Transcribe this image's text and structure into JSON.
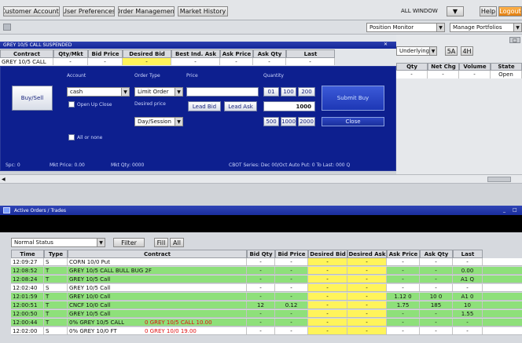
{
  "menu": {
    "tabs": [
      "Customer Accounts",
      "User Preferences",
      "Order Management",
      "Market History"
    ],
    "window_label": "ALL WINDOW",
    "help": "Help",
    "logout": "Logout"
  },
  "toolbar": {
    "position_dd": "Position Monitor",
    "manage_dd": "Manage Portfolios"
  },
  "quote_grid": {
    "title": "GREY 10/5 CALL  SUSPENDED",
    "headers": [
      "Contract",
      "Qty/Mkt",
      "Bid Price",
      "Desired Bid",
      "Best Ind. Ask",
      "Ask Price",
      "Ask Qty",
      "Last"
    ],
    "row": [
      "GREY 10/5 CALL",
      "-",
      "-",
      "-",
      "-",
      "-",
      "-",
      "-"
    ]
  },
  "order_ticket": {
    "labels": {
      "account": "Account",
      "order_type": "Order Type",
      "price": "Price",
      "quantity": "Quantity"
    },
    "buysell_button": "Buy/Sell",
    "account_value": "cash",
    "open_close_label": "Open Up Close",
    "order_type_value": "Limit Order",
    "desired_label": "Desired price",
    "lead_bid": "Lead Bid",
    "lead_ask": "Lead Ask",
    "qty_buttons": [
      "01",
      "100",
      "200"
    ],
    "qty_value": "1000",
    "qty_buttons2": [
      "500",
      "1000",
      "2000"
    ],
    "tif_value": "Day/Session",
    "submit_button": "Submit Buy",
    "close_button": "Close",
    "all_or_none": "All or none",
    "status": [
      "Spc: 0",
      "Mkt Price: 0.00",
      "Mkt Qty: 0000",
      "CBOT Series: Dec 00/Oct  Auto Put: 0 To  Last: 000 Q"
    ]
  },
  "right_panel": {
    "filter_value": "Underlying",
    "btn_a": "5A",
    "btn_b": "4H",
    "headers": [
      "Qty",
      "Net Chg",
      "Volume",
      "State"
    ],
    "row": [
      "-",
      "-",
      "-",
      "Open"
    ]
  },
  "lower_window": {
    "title": "Active Orders / Trades",
    "filter_value": "Normal Status",
    "filter_btn": "Filter",
    "btn1": "Fill",
    "btn2": "All",
    "headers": [
      "Time",
      "Type",
      "Contract",
      "Bid Qty",
      "Bid Price",
      "Desired Bid",
      "Desired Ask",
      "Ask Price",
      "Ask Qty",
      "Last"
    ],
    "rows": [
      {
        "time": "12:09:27",
        "type": "S",
        "contract": "CORN 10/0 Put",
        "bq": "-",
        "bp": "-",
        "db": "-",
        "da": "-",
        "ap": "-",
        "aq": "-",
        "last": "-",
        "color": "#ffffff"
      },
      {
        "time": "12:08:52",
        "type": "T",
        "contract": "GREY 10/5 CALL BULL BUG 2F",
        "bq": "-",
        "bp": "-",
        "db": "-",
        "da": "-",
        "ap": "-",
        "aq": "-",
        "last": "0.00",
        "color": "#8ee07a"
      },
      {
        "time": "12:08:24",
        "type": "T",
        "contract": "GREY 10/5 Call",
        "bq": "-",
        "bp": "-",
        "db": "-",
        "da": "-",
        "ap": "-",
        "aq": "-",
        "last": "A1 Q",
        "color": "#8ee07a"
      },
      {
        "time": "12:02:40",
        "type": "S",
        "contract": "GREY 10/5 Call",
        "bq": "-",
        "bp": "-",
        "db": "-",
        "da": "-",
        "ap": "-",
        "aq": "-",
        "last": "-",
        "color": "#ffffff"
      },
      {
        "time": "12:01:59",
        "type": "T",
        "contract": "GREY 10/0 Call",
        "bq": "-",
        "bp": "-",
        "db": "-",
        "da": "-",
        "ap": "1.12 0",
        "aq": "10 0",
        "last": "A1 0",
        "color": "#8ee07a"
      },
      {
        "time": "12:00:51",
        "type": "T",
        "contract": "CNCF 10/0 Call",
        "bq": "12",
        "bp": "0.12",
        "db": "-",
        "da": "-",
        "ap": "1.75",
        "aq": "185",
        "last": "10",
        "color": "#8ee07a"
      },
      {
        "time": "12:00:50",
        "type": "T",
        "contract": "GREY 10/5 Call",
        "bq": "-",
        "bp": "-",
        "db": "-",
        "da": "-",
        "ap": "-",
        "aq": "-",
        "last": "1.55",
        "color": "#8ee07a"
      },
      {
        "time": "12:00:44",
        "type": "T",
        "contract": "0% GREY 10/5 CALL",
        "contract_red": "0 GREY 10/5 CALL 10.00",
        "bq": "-",
        "bp": "-",
        "db": "-",
        "da": "-",
        "ap": "-",
        "aq": "-",
        "last": "-",
        "color": "#8ee07a"
      },
      {
        "time": "12:02:00",
        "type": "S",
        "contract": "0% GREY 10/0 FT",
        "contract_red": "0 GREY 10/0 19.00",
        "bq": "-",
        "bp": "-",
        "db": "-",
        "da": "-",
        "ap": "-",
        "aq": "-",
        "last": "-",
        "color": "#ffffff"
      }
    ]
  }
}
